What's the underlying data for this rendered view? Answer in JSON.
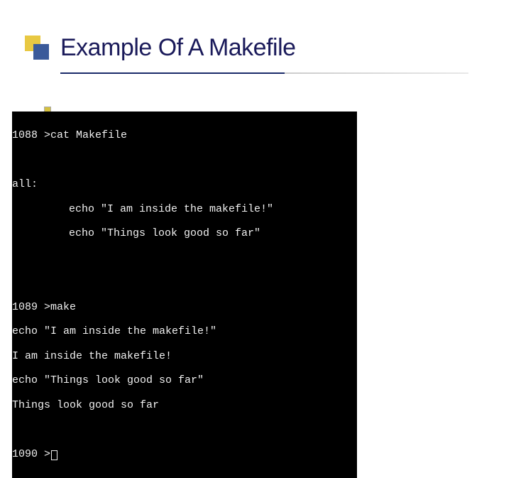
{
  "title": "Example Of A Makefile",
  "terminal": {
    "block1": {
      "line1": "1088 >cat Makefile",
      "blank": "",
      "line2": "all:",
      "line3": "echo \"I am inside the makefile!\"",
      "line4": "echo \"Things look good so far\""
    },
    "block2": {
      "line1": "1089 >make",
      "line2": "echo \"I am inside the makefile!\"",
      "line3": "I am inside the makefile!",
      "line4": "echo \"Things look good so far\"",
      "line5": "Things look good so far"
    },
    "block3": {
      "prompt": "1090 >"
    }
  }
}
